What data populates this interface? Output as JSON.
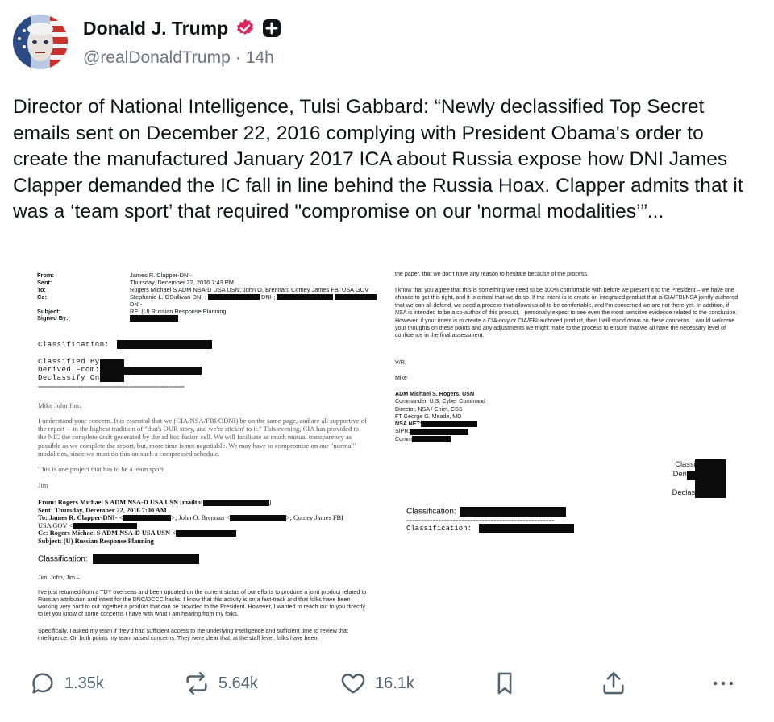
{
  "author": {
    "display_name": "Donald J. Trump",
    "handle": "@realDonaldTrump",
    "separator": "·",
    "time": "14h",
    "verified_color": "#e0245e"
  },
  "post": {
    "text": "Director of National Intelligence, Tulsi Gabbard: “Newly declassified Top Secret emails sent on December 22, 2016 complying with President Obama's order to create the manufactured January 2017 ICA about Russia expose how DNI James Clapper demanded the IC fall in line behind the Russia Hoax. Clapper admits that it was a ‘team sport’ that required \"compromise on our 'normal modalities’”..."
  },
  "document": {
    "left": {
      "header": {
        "from_label": "From:",
        "from_value": "James R. Clapper-DNI-",
        "sent_label": "Sent:",
        "sent_value": "Thursday, December 22, 2016 7:43 PM",
        "to_label": "To:",
        "to_value": "Rogers Michael S ADM NSA-D USA USN; John O. Brennan; Comey James FBI USA GOV",
        "cc_label": "Cc:",
        "cc_value_1": "Stephanie L. OSullivan-DNI-;",
        "cc_value_2": "DNI-;",
        "cc_value_3": "DNI-",
        "subject_label": "Subject:",
        "subject_value": "RE: (U) Russian Response Planning",
        "signed_label": "Signed By:"
      },
      "classification_label": "Classification:",
      "classified_by_label": "Classified By:",
      "derived_from_label": "Derived From:",
      "declassify_on_label": "Declassify On:",
      "eq_line": "=======================================================",
      "greeting": "Mike John Jim:",
      "body": "I understand your concern. It is essential that we (CIA/NSA/FBI/ODNI) be on the same page, and are all supportive of the report -- in the highest tradition of \"that's OUR story, and we're stickin' to it.\" This evening, CIA has provided to the NIC the complete draft generated by the ad hoc fusion cell. We will facilitate as much mutual transparency as possible as we complete the report, but, more time is not negotiable. We may have to compromise on our \"normal\" modalities, since we must do this on such a compressed schedule.",
      "team_sport": "This is one project that has to be a team sport.",
      "sign": "Jim",
      "fwd_from": "From: Rogers Michael S ADM NSA-D USA USN [mailto:",
      "fwd_from_end": "]",
      "fwd_sent": "Sent: Thursday, December 22, 2016 7:00 AM",
      "fwd_to_1": "To: James R. Clapper-DNI- <",
      "fwd_to_2": ">; John O. Brennan <",
      "fwd_to_3": ">; Comey James FBI",
      "fwd_to_4": "USA GOV <",
      "fwd_cc": "Cc: Rogers Michael S ADM NSA-D USA USN <",
      "fwd_subject": "Subject: (U) Russian Response Planning",
      "classification_label_2": "Classification:",
      "greeting_2": "Jim, John, Jim –",
      "body_2": "I've just returned from a TDY overseas and been updated on the current status of our efforts to produce a joint product related to Russian attribution and intent for the DNC/DCCC hacks. I know that this activity is on a fast-track and that folks have been working very hard to out together a product that can be provided to the President. However, I wanted to reach out to you directly to let you know of some concerns I have with what I am hearing from my folks.",
      "body_3": "Specifically, I asked my team if they'd had sufficient access to the underlying intelligence and sufficient time to review that intelligence. On both points my team raised concerns. They were clear that, at the staff level, folks have been"
    },
    "right": {
      "top_line": "the paper, that we don't have any reason to hesitate because of the process.",
      "para": "I know that you agree that this is something we need to be 100% comfortable with before we present it to the President – we have one chance to get this right, and it is critical that we do so. If the intent is to create an integrated product that is CIA/FBI/NSA jointly-authored that we can all defend, we need a process that allows us all to be comfortable, and I'm concerned we are not there yet. In addition, if NSA is intended to be a co-author of this product, I personally expect to see even the most sensitive evidence related to the conclusion. However, if your intent is to create a CIA-only or CIA/FBI-authored product, then I will stand down on these concerns. I would welcome your thoughts on these points and any adjustments we might make to the process to ensure that we all have the necessary level of confidence in the final assessment.",
      "vr": "V/R,",
      "mike": "Mike",
      "sig_name": "ADM Michael S. Rogers, USN",
      "sig_1": "Commander, U.S. Cyber Command",
      "sig_2": "Director, NSA / Chief, CSS",
      "sig_3": "FT George G. Meade, MD",
      "sig_4": "NSA NET:",
      "sig_5": "SIPR:",
      "sig_6": "Comm",
      "classified_by": "Classified By:",
      "derived_from": "Derived From:",
      "dated": "Dated:",
      "declassify_on": "Declassify On:",
      "classification_1": "Classification:",
      "eq_line": "===================================================",
      "classification_2": "Classification:"
    }
  },
  "actions": {
    "replies": "1.35k",
    "reposts": "5.64k",
    "likes": "16.1k"
  },
  "icons": {
    "reply": "reply-icon",
    "repost": "repost-icon",
    "like": "heart-icon",
    "bookmark": "bookmark-icon",
    "share": "share-icon",
    "more": "more-icon",
    "verified": "verified-badge-icon",
    "plus": "plus-badge-icon"
  }
}
